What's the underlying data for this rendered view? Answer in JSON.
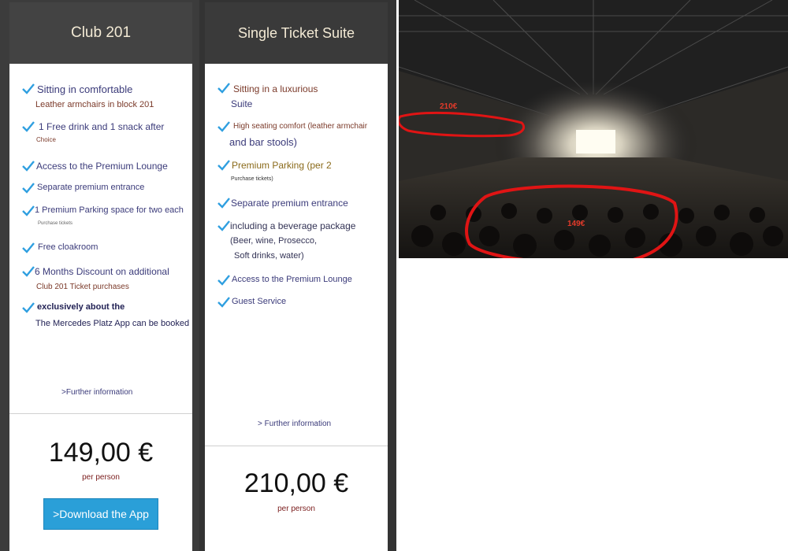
{
  "club201": {
    "title": "Club 201",
    "features": [
      {
        "line1": "Sitting in comfortable",
        "line2": "Leather armchairs in block 201"
      },
      {
        "line1": "1 Free drink and 1 snack after",
        "line2": "Choice"
      },
      {
        "line1": "Access to the Premium Lounge",
        "line2": ""
      },
      {
        "line1": "Separate premium entrance",
        "line2": ""
      },
      {
        "line1": "1 Premium Parking space for two each",
        "line2": "Purchase tickets"
      },
      {
        "line1": "Free cloakroom",
        "line2": ""
      },
      {
        "line1": "6 Months Discount on additional",
        "line2": "Club 201 Ticket purchases"
      },
      {
        "line1": "exclusively about the",
        "line2": "The Mercedes Platz App can be booked"
      }
    ],
    "more": ">Further information",
    "price": "149,00 €",
    "per": "per person",
    "button": ">Download the App"
  },
  "suite": {
    "title": "Single Ticket Suite",
    "features": [
      {
        "line1": "Sitting in a luxurious",
        "line2": "Suite"
      },
      {
        "line1": "High seating comfort (leather armchair",
        "line2": "and bar stools)"
      },
      {
        "line1": "Premium Parking (per 2",
        "line2": "Purchase tickets)"
      },
      {
        "line1": "Separate premium entrance",
        "line2": ""
      },
      {
        "line1": "including a beverage package",
        "line2": "(Beer, wine, Prosecco,",
        "line3": "Soft drinks, water)"
      },
      {
        "line1": "Access to the Premium Lounge",
        "line2": ""
      },
      {
        "line1": "Guest Service",
        "line2": ""
      }
    ],
    "more": "> Further information",
    "price": "210,00 €",
    "per": "per person"
  },
  "photo": {
    "tag_top": "210€",
    "tag_bottom": "149€",
    "highlight_color": "#e01414"
  }
}
